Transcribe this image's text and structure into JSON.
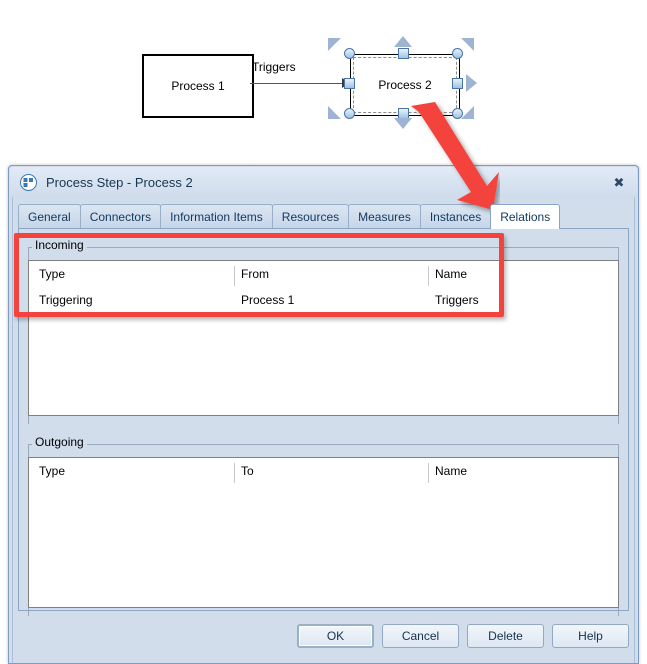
{
  "diagram": {
    "node1": {
      "label": "Process 1"
    },
    "node2": {
      "label": "Process 2"
    },
    "connector": {
      "label": "Triggers"
    },
    "selection_handles": "resize-handles",
    "annotation_arrow": "red-arrow-pointing-to-relations-tab",
    "annotation_box": "red-highlight-box-around-incoming-table"
  },
  "dialog": {
    "title": "Process Step - Process 2",
    "icon": "process-step-icon",
    "close_label": "✖",
    "tabs": [
      {
        "label": "General",
        "active": false
      },
      {
        "label": "Connectors",
        "active": false
      },
      {
        "label": "Information Items",
        "active": false
      },
      {
        "label": "Resources",
        "active": false
      },
      {
        "label": "Measures",
        "active": false
      },
      {
        "label": "Instances",
        "active": false
      },
      {
        "label": "Relations",
        "active": true
      }
    ],
    "incoming": {
      "group_label": "Incoming",
      "columns": [
        "Type",
        "From",
        "Name"
      ],
      "rows": [
        [
          "Triggering",
          "Process 1",
          "Triggers"
        ]
      ]
    },
    "outgoing": {
      "group_label": "Outgoing",
      "columns": [
        "Type",
        "To",
        "Name"
      ],
      "rows": []
    },
    "buttons": [
      {
        "label": "OK",
        "default": true
      },
      {
        "label": "Cancel",
        "default": false
      },
      {
        "label": "Delete",
        "default": false
      },
      {
        "label": "Help",
        "default": false
      }
    ]
  },
  "colors": {
    "dialog_bg": "#d2ddec",
    "titlebar": "#dbe6f3",
    "tab_active": "#ffffff",
    "annotation_red": "#f4433c",
    "handle_blue": "#9cc4e4",
    "arrow_gray": "#9fb4d2"
  }
}
